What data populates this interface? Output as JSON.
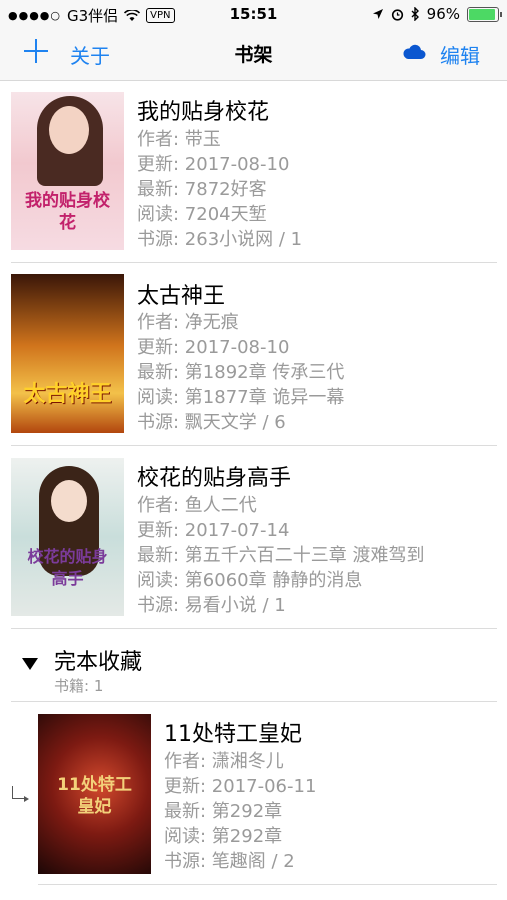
{
  "status_bar": {
    "carrier": "G3伴侣",
    "vpn": "VPN",
    "time": "15:51",
    "battery": "96%",
    "battery_level": 0.96
  },
  "nav": {
    "about_label": "关于",
    "title": "书架",
    "edit_label": "编辑"
  },
  "labels": {
    "author": "作者: ",
    "updated": "更新: ",
    "latest": "最新: ",
    "read": "阅读: ",
    "source": "书源: "
  },
  "books": [
    {
      "title": "我的贴身校花",
      "author": "带玉",
      "updated": "2017-08-10",
      "latest": "7872好客",
      "read": "7204天堑",
      "source": "263小说网 / 1",
      "cover_text": "我的贴身校花"
    },
    {
      "title": "太古神王",
      "author": "净无痕",
      "updated": "2017-08-10",
      "latest": "第1892章 传承三代",
      "read": "第1877章 诡异一幕",
      "source": "飘天文学 / 6",
      "cover_text": "太古神王"
    },
    {
      "title": "校花的贴身高手",
      "author": "鱼人二代",
      "updated": "2017-07-14",
      "latest": "第五千六百二十三章 渡难驾到",
      "read": "第6060章 静静的消息",
      "source": "易看小说 / 1",
      "cover_text": "校花的贴身高手"
    }
  ],
  "finished_section": {
    "title": "完本收藏",
    "count": "书籍: 1",
    "books": [
      {
        "title": "11处特工皇妃",
        "author": "潇湘冬儿",
        "updated": "2017-06-11",
        "latest": "第292章",
        "read": "第292章",
        "source": "笔趣阁 / 2",
        "cover_text": "11处特工皇妃"
      }
    ]
  },
  "colors": {
    "accent": "#1f83f0",
    "meta_text": "#9a9a9a",
    "battery": "#4cd964"
  }
}
